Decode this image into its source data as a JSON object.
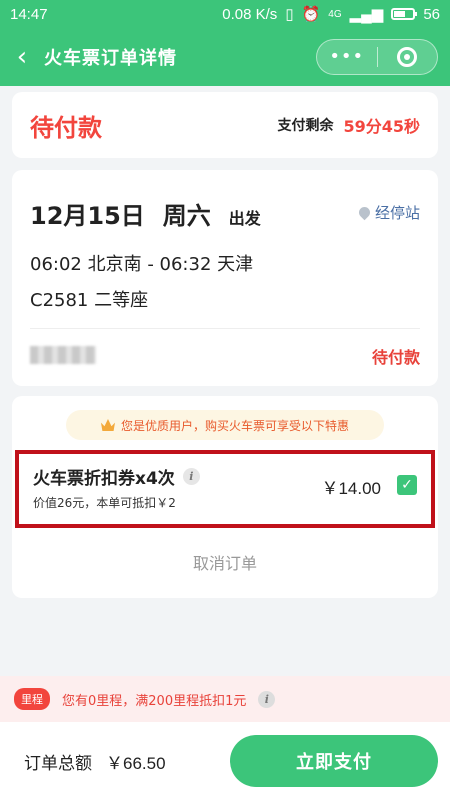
{
  "status_bar": {
    "time": "14:47",
    "net_speed": "0.08 K/s",
    "signal_label": "4G",
    "battery": "56"
  },
  "nav": {
    "title": "火车票订单详情",
    "back_icon": "chevron-left-icon",
    "more_label": "•••",
    "close_icon": "target-icon"
  },
  "order_status": {
    "state": "待付款",
    "remain_label": "支付剩余",
    "countdown": "59分45秒"
  },
  "trip": {
    "date": "12月15日",
    "weekday": "周六",
    "depart_label": "出发",
    "stops_link": "经停站",
    "route": "06:02 北京南 - 06:32 天津",
    "train_seat": "C2581 二等座",
    "passenger_status": "待付款"
  },
  "offer": {
    "vip_banner": "您是优质用户，购买火车票可享受以下特惠",
    "coupon_title": "火车票折扣券x4次",
    "coupon_sub": "价值26元，本单可抵扣￥2",
    "coupon_price": "￥14.00",
    "coupon_checked": true,
    "cancel_label": "取消订单"
  },
  "mileage": {
    "badge": "里程",
    "text": "您有0里程，满200里程抵扣1元"
  },
  "footer": {
    "total_label": "订单总额",
    "total_amount": "￥66.50",
    "pay_label": "立即支付"
  },
  "colors": {
    "brand_green": "#3cc57a",
    "alert_red": "#f2453d",
    "highlight_box": "#c0111a"
  }
}
